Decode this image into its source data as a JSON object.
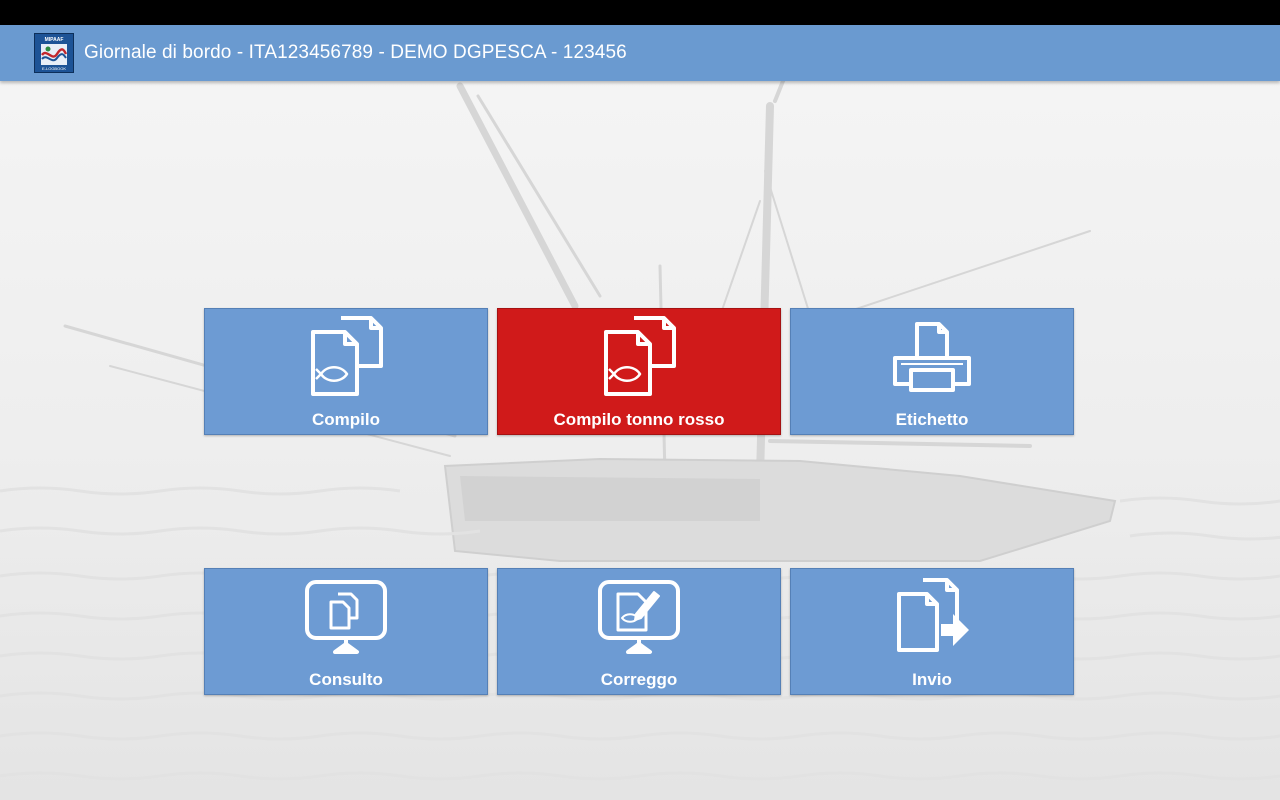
{
  "status_bar": {},
  "app_bar": {
    "logo_top_text": "MIPAAF",
    "logo_bottom_text": "E-LOGBOOK",
    "title": "Giornale di bordo - ITA123456789 - DEMO DGPESCA - 123456",
    "color": "#6a9ad0"
  },
  "menu": {
    "tiles": [
      {
        "label": "Compilo",
        "icon": "fish-documents-icon",
        "active": false
      },
      {
        "label": "Compilo tonno rosso",
        "icon": "fish-documents-icon",
        "active": true
      },
      {
        "label": "Etichetto",
        "icon": "printer-icon",
        "active": false
      },
      {
        "label": "Consulto",
        "icon": "monitor-documents-icon",
        "active": false
      },
      {
        "label": "Correggo",
        "icon": "monitor-edit-icon",
        "active": false
      },
      {
        "label": "Invio",
        "icon": "send-documents-icon",
        "active": false
      }
    ]
  },
  "colors": {
    "tile": "#6d9bd3",
    "tile_active": "#d01a1a",
    "background": "#eeeeee"
  }
}
